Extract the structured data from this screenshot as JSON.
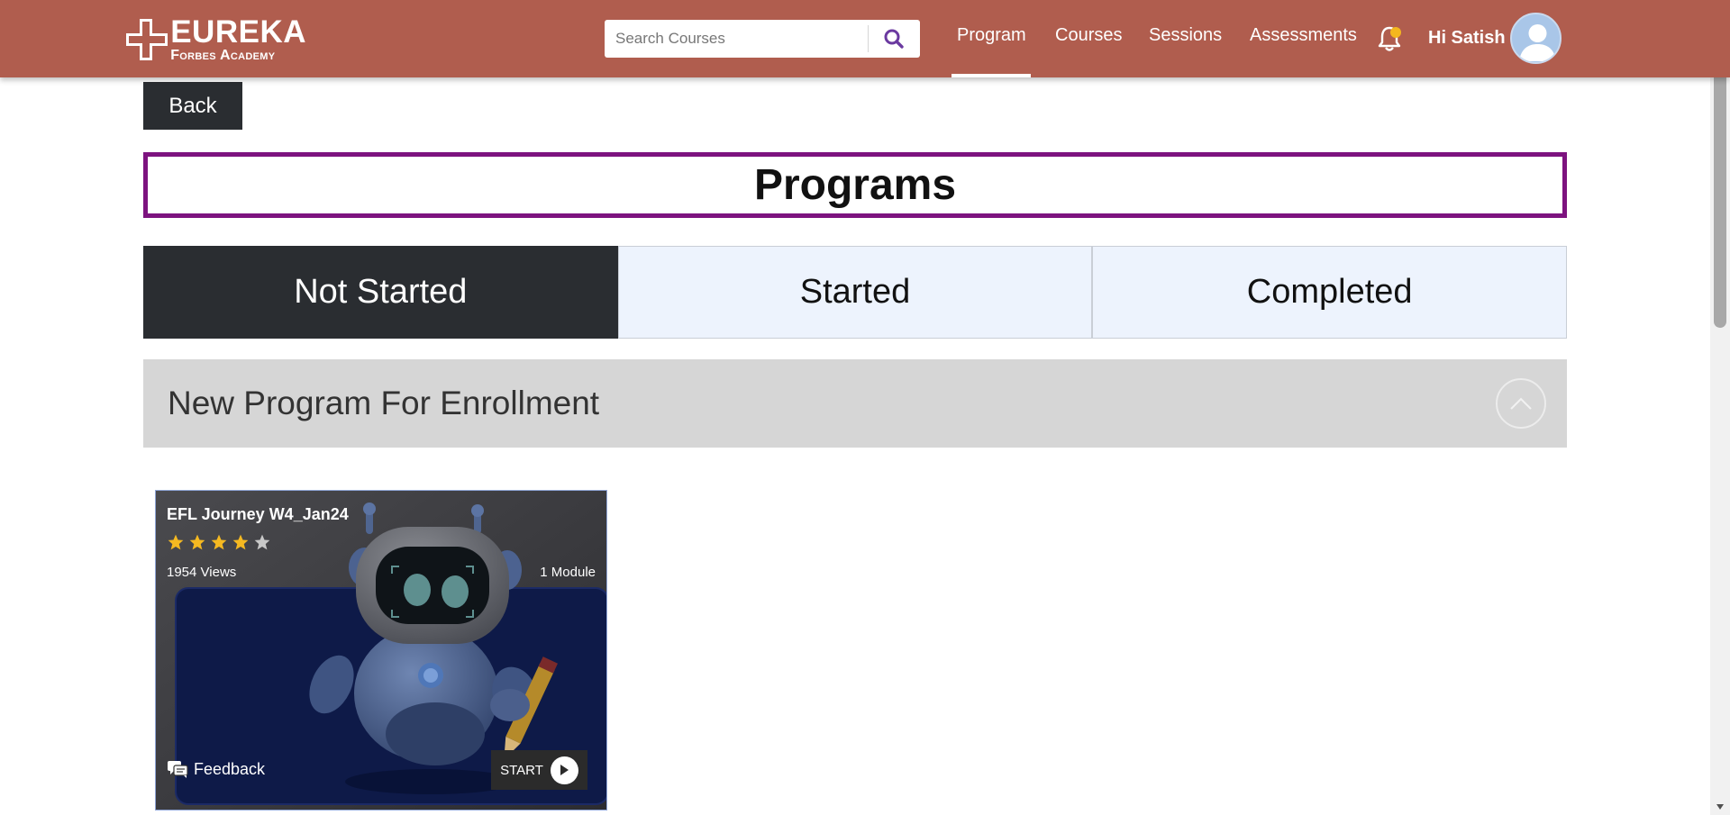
{
  "header": {
    "logo_main": "EUREKA",
    "logo_sub": "Forbes Academy",
    "search_placeholder": "Search Courses",
    "nav": [
      {
        "label": "Program",
        "active": true
      },
      {
        "label": "Courses",
        "active": false
      },
      {
        "label": "Sessions",
        "active": false
      },
      {
        "label": "Assessments",
        "active": false
      }
    ],
    "greeting": "Hi Satish",
    "colors": {
      "bar": "#b05d4e",
      "search_icon": "#6b3aa0"
    }
  },
  "back_label": "Back",
  "page_title": "Programs",
  "tabs": [
    {
      "label": "Not Started",
      "active": true
    },
    {
      "label": "Started",
      "active": false
    },
    {
      "label": "Completed",
      "active": false
    }
  ],
  "section": {
    "title": "New Program For Enrollment",
    "collapse_icon": "chevron-up-icon"
  },
  "cards": [
    {
      "title": "EFL Journey W4_Jan24",
      "rating": 4,
      "rating_max": 5,
      "views": "1954 Views",
      "modules": "1 Module",
      "feedback_label": "Feedback",
      "start_label": "START"
    }
  ],
  "icons": {
    "search": "search-icon",
    "bell": "bell-icon",
    "avatar": "user-avatar-icon",
    "feedback": "feedback-icon",
    "play": "play-icon"
  }
}
